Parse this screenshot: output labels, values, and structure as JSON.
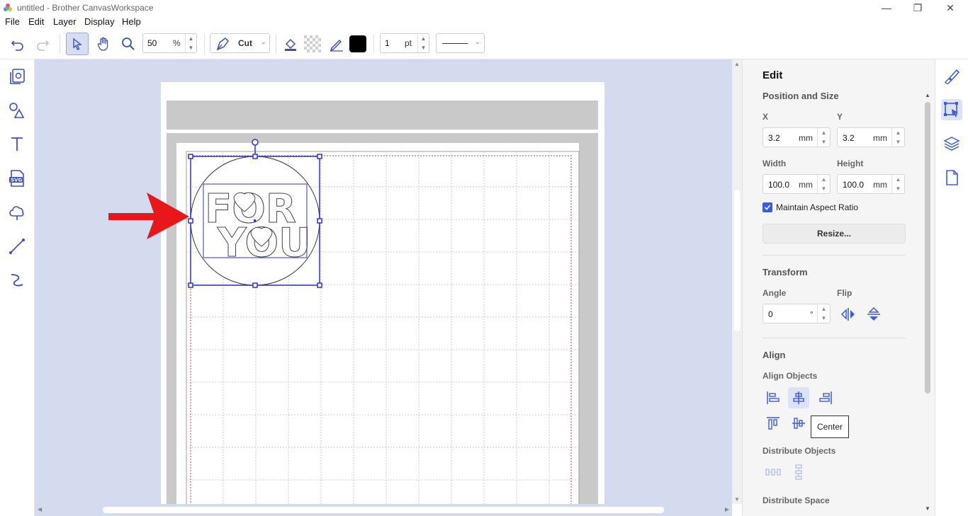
{
  "window": {
    "title": "untitled - Brother CanvasWorkspace",
    "minimize": "—",
    "restore": "❐",
    "close": "✕"
  },
  "menu": {
    "file": "File",
    "edit": "Edit",
    "layer": "Layer",
    "display": "Display",
    "help": "Help"
  },
  "toolbar": {
    "zoom_value": "50",
    "zoom_unit": "%",
    "mode_label": "Cut",
    "fill_color": "#000000",
    "stroke_width_value": "1",
    "stroke_width_unit": "pt"
  },
  "canvas": {
    "design_text_line1": "FOR",
    "design_text_line2": "YOU",
    "accent_color": "#2b35c4",
    "arrow_color": "#e8181a"
  },
  "panel": {
    "title": "Edit",
    "position_size_header": "Position and Size",
    "x_label": "X",
    "y_label": "Y",
    "x_value": "3.2",
    "y_value": "3.2",
    "width_label": "Width",
    "height_label": "Height",
    "width_value": "100.0",
    "height_value": "100.0",
    "unit": "mm",
    "maintain_aspect_label": "Maintain Aspect Ratio",
    "maintain_aspect_checked": true,
    "resize_button": "Resize...",
    "transform_header": "Transform",
    "angle_label": "Angle",
    "angle_value": "0",
    "angle_unit": "°",
    "flip_label": "Flip",
    "align_header": "Align",
    "align_objects_label": "Align Objects",
    "tooltip_center": "Center",
    "distribute_objects_label": "Distribute Objects",
    "distribute_space_label": "Distribute Space"
  }
}
